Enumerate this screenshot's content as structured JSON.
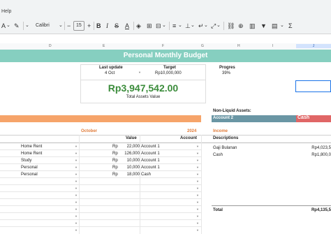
{
  "menu": {
    "help": "Help"
  },
  "toolbar": {
    "font": "Calibri",
    "font_size": "15"
  },
  "columns": [
    "D",
    "E",
    "F",
    "G",
    "H",
    "I",
    "J"
  ],
  "sheet": {
    "title": "Personal Monthly Budget",
    "stats": {
      "last_update_label": "Last update",
      "last_update_value": "4 Oct",
      "target_label": "Target",
      "target_value": "Rp10,000,000",
      "progress_label": "Progres",
      "progress_value": "39%",
      "total_assets": "Rp3,947,542.00",
      "total_assets_label": "Total Assets Value"
    },
    "non_liquid": {
      "title": "Non-Liquid Assets:",
      "account_header": "Account 2",
      "cash_header": "Cash"
    },
    "expenses": {
      "month": "October",
      "year": "2024",
      "value_header": "Value",
      "account_header": "Account",
      "rows": [
        {
          "category": "Home Rent",
          "currency": "Rp",
          "amount": "22,000",
          "account": "Account 1"
        },
        {
          "category": "Home Rent",
          "currency": "Rp",
          "amount": "126,000",
          "account": "Account 1"
        },
        {
          "category": "Study",
          "currency": "Rp",
          "amount": "10,000",
          "account": "Account 1"
        },
        {
          "category": "Personal",
          "currency": "Rp",
          "amount": "10,000",
          "account": "Account 1"
        },
        {
          "category": "Personal",
          "currency": "Rp",
          "amount": "18,000",
          "account": "Cash"
        }
      ]
    },
    "income": {
      "title": "Income",
      "descriptions_header": "Descriptions",
      "rows": [
        {
          "description": "Gaji Bulanan",
          "value": "Rp4,023,5"
        },
        {
          "description": "Cash",
          "value": "Rp1,800,0"
        }
      ],
      "total_label": "Total",
      "total_value": "Rp4,135,5"
    }
  }
}
